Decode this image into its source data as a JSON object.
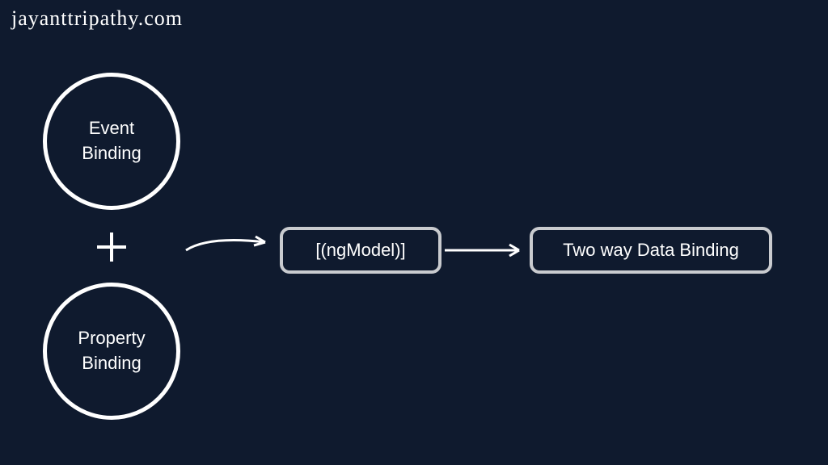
{
  "watermark": "jayanttripathy.com",
  "circles": {
    "event": {
      "line1": "Event",
      "line2": "Binding"
    },
    "property": {
      "line1": "Property",
      "line2": "Binding"
    }
  },
  "boxes": {
    "ngmodel": "[(ngModel)]",
    "twoway": "Two way Data Binding"
  }
}
